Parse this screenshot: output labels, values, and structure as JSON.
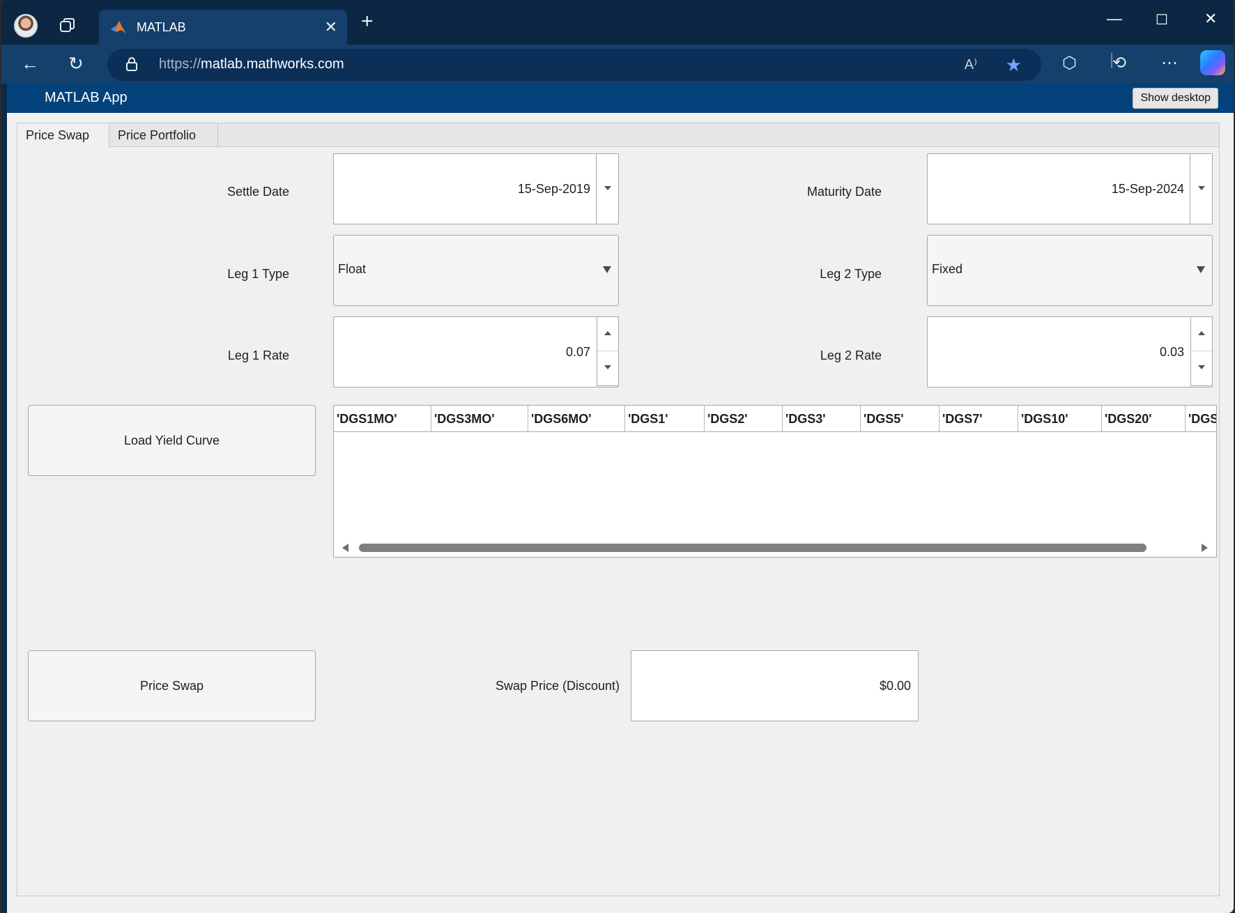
{
  "browser": {
    "tab_title": "MATLAB",
    "url_protocol": "https://",
    "url_host": "matlab.mathworks.com",
    "read_aloud_label": "A⁾",
    "icons": [
      "profile-avatar",
      "workspaces-icon",
      "matlab-logo",
      "close-icon",
      "plus-icon",
      "back-icon",
      "refresh-icon",
      "lock-icon",
      "read-aloud-icon",
      "favorite-star-icon",
      "extensions-icon",
      "history-icon",
      "more-icon",
      "copilot-icon",
      "minimize-icon",
      "maximize-icon",
      "window-close-icon"
    ],
    "accent_color": "#6ea8ff"
  },
  "app": {
    "title": "MATLAB App",
    "show_desktop": "Show desktop",
    "header_color": "#03427a",
    "tabs": [
      "Price Swap",
      "Price Portfolio"
    ],
    "active_tab": "Price Swap",
    "settle_date_label": "Settle Date",
    "settle_date": "15-Sep-2019",
    "maturity_date_label": "Maturity Date",
    "maturity_date": "15-Sep-2024",
    "leg1_type_label": "Leg 1 Type",
    "leg1_type": "Float",
    "leg2_type_label": "Leg 2 Type",
    "leg2_type": "Fixed",
    "leg1_rate_label": "Leg 1 Rate",
    "leg1_rate": "0.07",
    "leg2_rate_label": "Leg 2 Rate",
    "leg2_rate": "0.03",
    "load_yield_curve": "Load Yield Curve",
    "table_columns": [
      "'DGS1MO'",
      "'DGS3MO'",
      "'DGS6MO'",
      "'DGS1'",
      "'DGS2'",
      "'DGS3'",
      "'DGS5'",
      "'DGS7'",
      "'DGS10'",
      "'DGS20'",
      "'DGS"
    ],
    "price_swap_button": "Price Swap",
    "swap_price_label": "Swap Price (Discount)",
    "swap_price": "$0.00"
  }
}
